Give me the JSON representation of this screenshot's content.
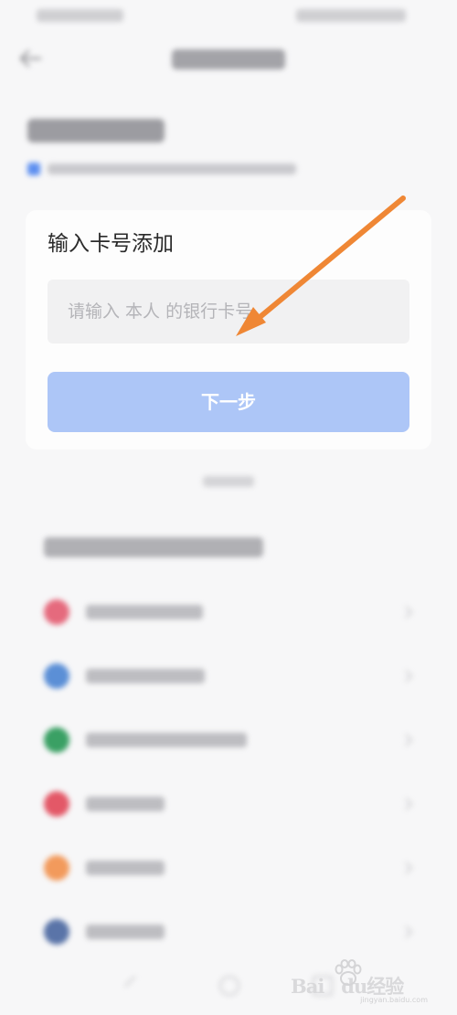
{
  "card": {
    "title": "输入卡号添加",
    "input_placeholder": "请输入 本人 的银行卡号",
    "input_value": "",
    "next_label": "下一步"
  },
  "bank_list": [
    {
      "icon_color": "#e56a7d"
    },
    {
      "icon_color": "#5b8fd6"
    },
    {
      "icon_color": "#3aa064"
    },
    {
      "icon_color": "#e35867"
    },
    {
      "icon_color": "#f29a5c"
    },
    {
      "icon_color": "#5a74a8"
    }
  ],
  "colors": {
    "background": "#f7f7f8",
    "primary_button_disabled": "#adc6f7",
    "arrow": "#ef8735"
  },
  "icons": {
    "back": "arrow-left",
    "chevron": "chevron-right",
    "annotation": "orange-arrow"
  },
  "watermark": {
    "logo": "Baidu经验",
    "url": "jingyan.baidu.com"
  }
}
